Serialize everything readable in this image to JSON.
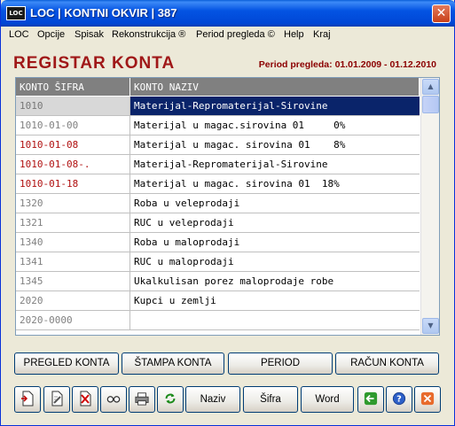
{
  "window": {
    "app_icon_text": "LOC",
    "title": "LOC | KONTNI OKVIR  |  387"
  },
  "menu": [
    "LOC",
    "Opcije",
    "Spisak",
    "Rekonstrukcija ®",
    "Period pregleda ©",
    "Help",
    "Kraj"
  ],
  "header": {
    "title": "REGISTAR KONTA",
    "period": "Period pregleda: 01.01.2009 - 01.12.2010"
  },
  "table": {
    "columns": [
      "KONTO ŠIFRA",
      "KONTO NAZIV"
    ],
    "rows": [
      {
        "sifra": "1010",
        "naziv": "Materijal-Repromaterijal-Sirovine",
        "selected": true,
        "red": false
      },
      {
        "sifra": "1010-01-00",
        "naziv": "Materijal u magac.sirovina 01     0%",
        "selected": false,
        "red": false
      },
      {
        "sifra": "1010-01-08",
        "naziv": "Materijal u magac. sirovina 01    8%",
        "selected": false,
        "red": true
      },
      {
        "sifra": "1010-01-08-.",
        "naziv": "Materijal-Repromaterijal-Sirovine",
        "selected": false,
        "red": true
      },
      {
        "sifra": "1010-01-18",
        "naziv": "Materijal u magac. sirovina 01  18%",
        "selected": false,
        "red": true
      },
      {
        "sifra": "1320",
        "naziv": "Roba u veleprodaji",
        "selected": false,
        "red": false
      },
      {
        "sifra": "1321",
        "naziv": "RUC u veleprodaji",
        "selected": false,
        "red": false
      },
      {
        "sifra": "1340",
        "naziv": "Roba u maloprodaji",
        "selected": false,
        "red": false
      },
      {
        "sifra": "1341",
        "naziv": "RUC u maloprodaji",
        "selected": false,
        "red": false
      },
      {
        "sifra": "1345",
        "naziv": "Ukalkulisan porez maloprodaje robe",
        "selected": false,
        "red": false
      },
      {
        "sifra": "2020",
        "naziv": "Kupci u zemlji",
        "selected": false,
        "red": false
      },
      {
        "sifra": "2020-0000",
        "naziv": "",
        "selected": false,
        "red": false
      }
    ]
  },
  "buttons": {
    "pregled": "PREGLED KONTA",
    "stampa": "ŠTAMPA KONTA",
    "period": "PERIOD",
    "racun": "RAČUN KONTA",
    "naziv": "Naziv",
    "sifra": "Šifra",
    "word": "Word"
  },
  "colors": {
    "selection": "#0A246A",
    "title_red": "#A01818",
    "code_red": "#B01010"
  }
}
